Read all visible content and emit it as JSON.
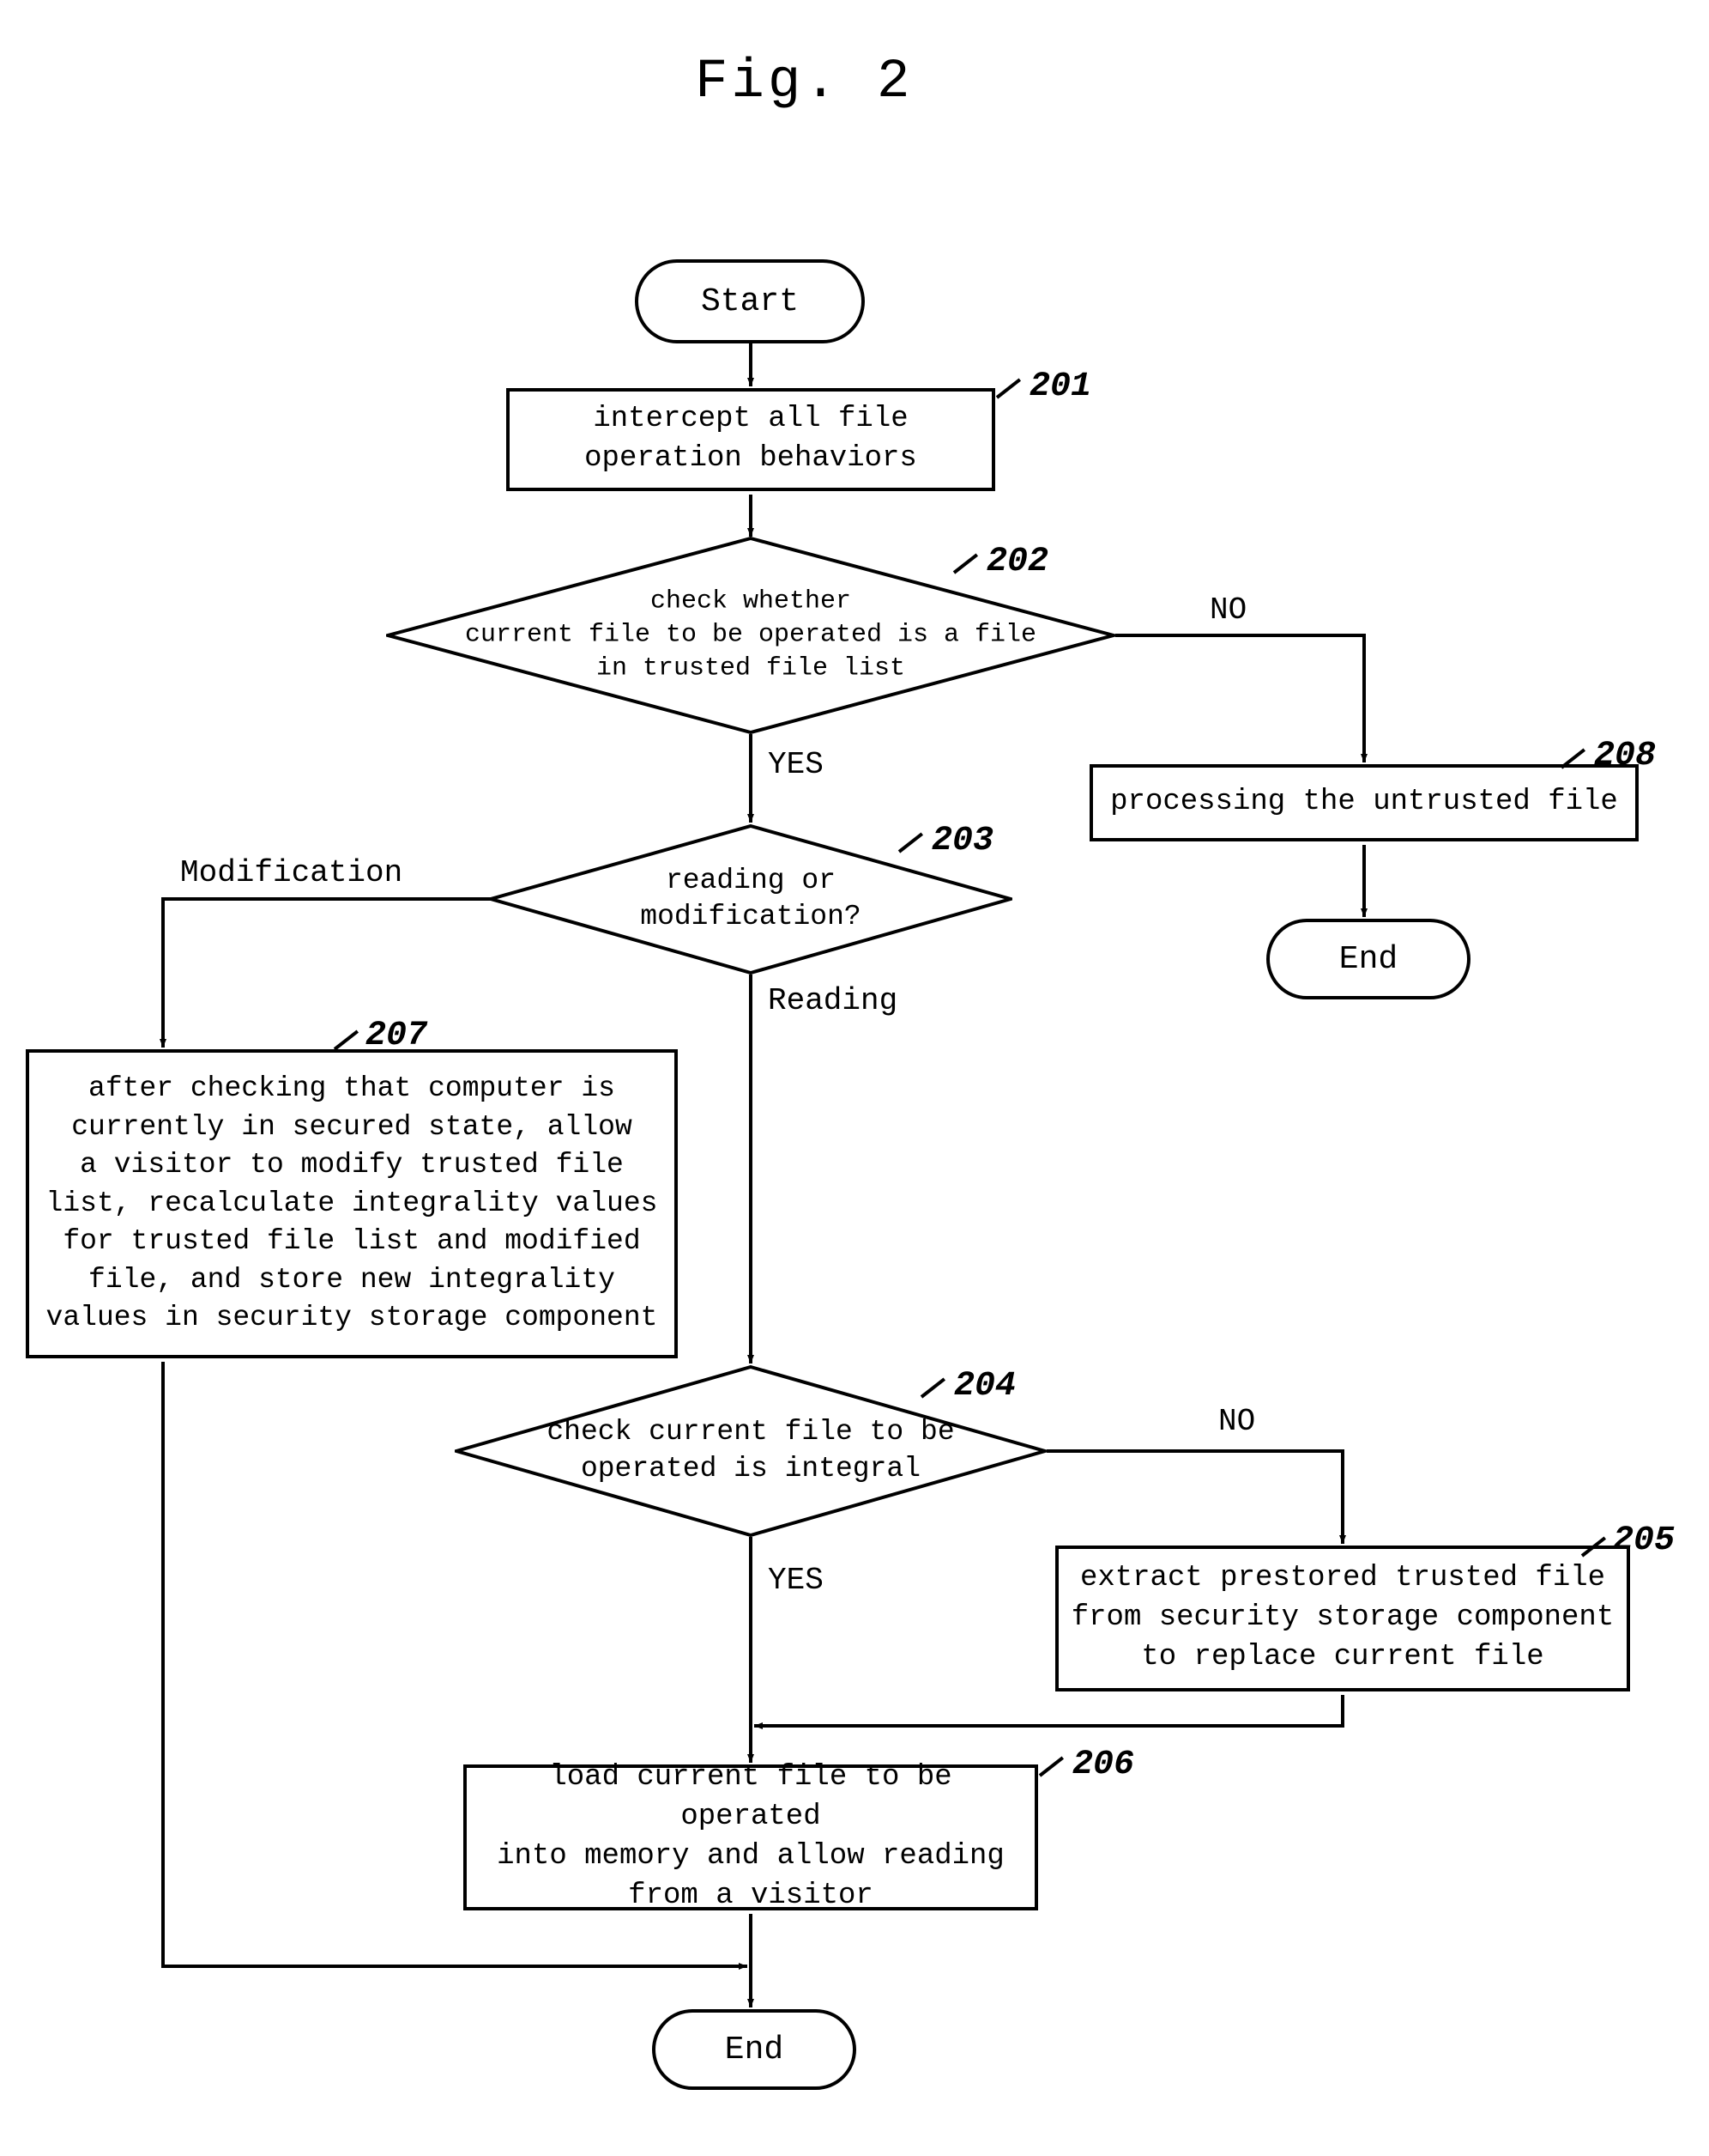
{
  "figure": {
    "title": "Fig. 2"
  },
  "nodes": {
    "start": "Start",
    "n201": "intercept all file\noperation behaviors",
    "n202": "check whether\ncurrent file to be operated is a file\nin trusted file list",
    "n203": "reading or\nmodification?",
    "n204": "check current file to be\noperated is integral",
    "n205": "extract prestored trusted file\nfrom security storage component\nto replace current file",
    "n206": "load current file to be operated\ninto memory and allow reading\nfrom a visitor",
    "n207": "after checking that computer is\ncurrently in secured state, allow\na visitor to modify trusted file\nlist, recalculate integrality values\nfor trusted file list and modified\nfile, and store new integrality\nvalues in security storage component",
    "n208": "processing the untrusted file",
    "end1": "End",
    "end2": "End"
  },
  "edge_labels": {
    "d202_no": "NO",
    "d202_yes": "YES",
    "d203_mod": "Modification",
    "d203_read": "Reading",
    "d204_no": "NO",
    "d204_yes": "YES"
  },
  "refs": {
    "r201": "201",
    "r202": "202",
    "r203": "203",
    "r204": "204",
    "r205": "205",
    "r206": "206",
    "r207": "207",
    "r208": "208"
  }
}
